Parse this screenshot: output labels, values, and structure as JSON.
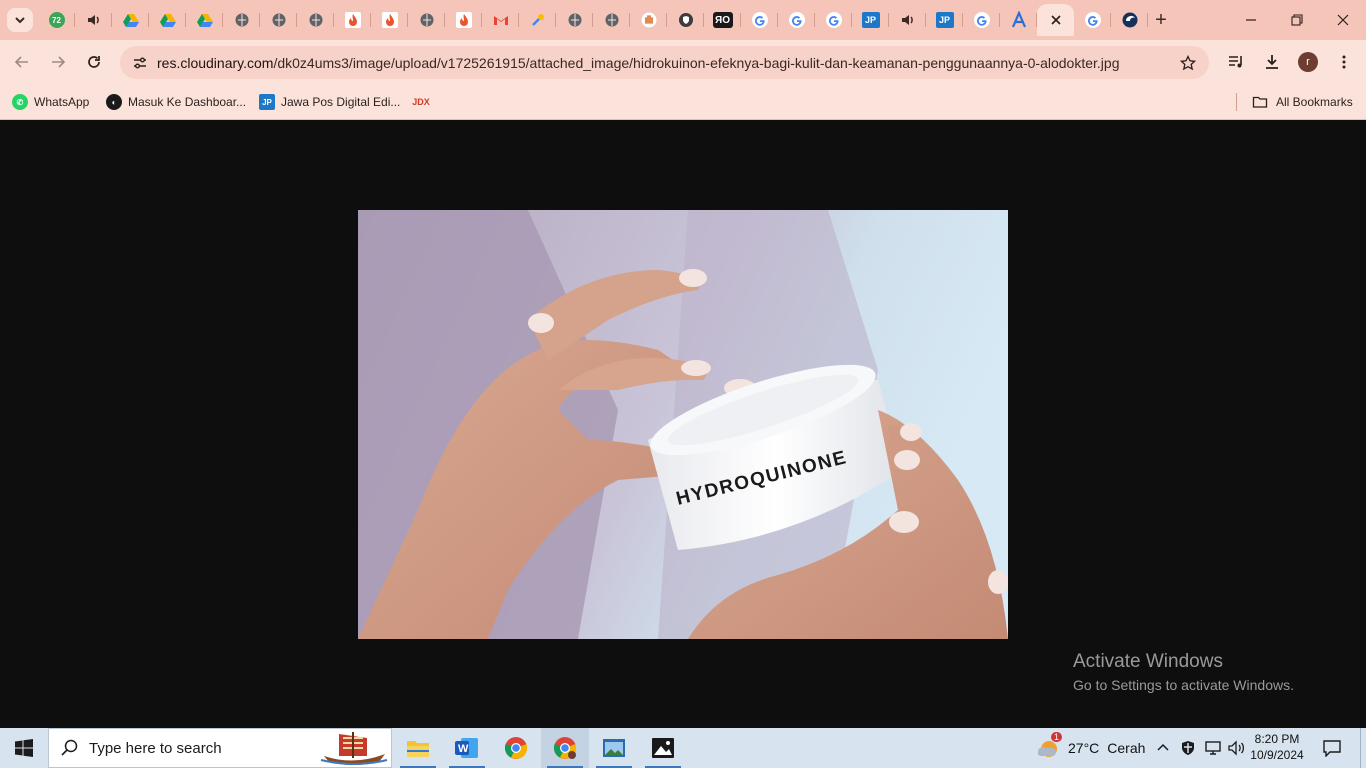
{
  "browser": {
    "tab_favicons": [
      "counter-badge-icon",
      "speaker-icon",
      "drive-icon",
      "drive-icon",
      "drive-icon",
      "globe-icon",
      "globe-icon",
      "globe-icon",
      "flame-icon",
      "flame-icon",
      "globe-icon",
      "flame-icon",
      "gmail-icon",
      "tools-icon",
      "globe-icon",
      "globe-icon",
      "hand-icon",
      "shield-icon",
      "ro-icon",
      "google-icon",
      "google-icon",
      "google-icon",
      "jp-icon",
      "speaker-icon",
      "jp-icon",
      "google-icon",
      "a-icon",
      "close-icon",
      "google-icon",
      "edge-icon"
    ],
    "tab_badge": "72",
    "url_host": "res.cloudinary.com",
    "url_path": "/dk0z4ums3/image/upload/v1725261915/attached_image/hidrokuinon-efeknya-bagi-kulit-dan-keamanan-penggunaannya-0-alodokter.jpg",
    "profile_initial": "r",
    "bookmarks": [
      {
        "label": "WhatsApp",
        "icon": "whatsapp-icon"
      },
      {
        "label": "Masuk Ke Dashboar...",
        "icon": "globe-icon"
      },
      {
        "label": "Jawa Pos Digital Edi...",
        "icon": "jp-icon"
      },
      {
        "label": "",
        "icon": "jdx-icon"
      }
    ],
    "all_bookmarks": "All Bookmarks"
  },
  "image": {
    "jar_label": "HYDROQUINONE"
  },
  "watermark": {
    "title": "Activate Windows",
    "subtitle": "Go to Settings to activate Windows."
  },
  "taskbar": {
    "search_placeholder": "Type here to search",
    "weather_badge": "1",
    "weather_temp": "27°C",
    "weather_text": "Cerah",
    "time": "8:20 PM",
    "date": "10/9/2024"
  },
  "colors": {
    "tab_strip": "#f5c5b9",
    "toolbar": "#fbe3dc",
    "page_bg": "#0e0e0e",
    "taskbar": "#d7e4f0"
  }
}
